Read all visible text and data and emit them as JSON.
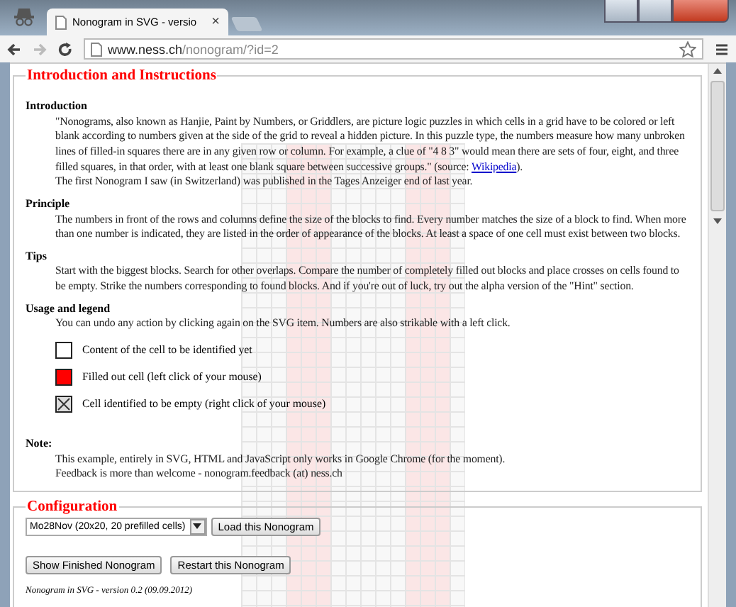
{
  "browser": {
    "tab_title": "Nonogram in SVG - versio",
    "tab_close": "×",
    "url_host": "www.ness.ch",
    "url_path": "/nonogram/?id=2"
  },
  "instructions": {
    "legend": "Introduction and Instructions",
    "topics": [
      {
        "heading": "Introduction",
        "paragraphs": [
          {
            "text": "\"Nonograms, also known as Hanjie, Paint by Numbers, or Griddlers, are picture logic puzzles in which cells in a grid have to be colored or left blank according to numbers given at the side of the grid to reveal a hidden picture. In this puzzle type, the numbers measure how many unbroken lines of filled-in squares there are in any given row or column. For example, a clue of \"4 8 3\" would mean there are sets of four, eight, and three filled squares, in that order, with at least one blank square between successive groups.\" (source: ",
            "link": "Wikipedia",
            "after": ")."
          },
          {
            "text": "The first Nonogram I saw (in Switzerland) was published in the Tages Anzeiger end of last year."
          }
        ]
      },
      {
        "heading": "Principle",
        "paragraphs": [
          {
            "text": "The numbers in front of the rows and columns define the size of the blocks to find. Every number matches the size of a block to find. When more than one number is indicated, they are listed in the order of appearance of the blocks. At least a space of one cell must exist between two blocks."
          }
        ]
      },
      {
        "heading": "Tips",
        "paragraphs": [
          {
            "text": "Start with the biggest blocks. Search for other overlaps. Compare the number of completely filled out blocks and place crosses on cells found to be empty. Strike the numbers corresponding to found blocks. And if you're out of luck, try out the alpha version of the \"Hint\" section."
          }
        ]
      },
      {
        "heading": "Usage and legend",
        "paragraphs": [
          {
            "text": "You can undo any action by clicking again on the SVG item. Numbers are also strikable with a left click."
          }
        ],
        "legend_items": [
          {
            "kind": "empty",
            "label": "Content of the cell to be identified yet"
          },
          {
            "kind": "filled",
            "label": "Filled out cell (left click of your mouse)"
          },
          {
            "kind": "crossed",
            "label": "Cell identified to be empty (right click of your mouse)"
          }
        ]
      },
      {
        "heading": "Note:",
        "paragraphs": [
          {
            "text": "This example, entirely in SVG, HTML and JavaScript only works in Google Chrome (for the moment)."
          },
          {
            "text": "Feedback is more than welcome - nonogram.feedback (at) ness.ch"
          }
        ]
      }
    ]
  },
  "configuration": {
    "legend": "Configuration",
    "select_value": "Mo28Nov (20x20, 20 prefilled cells)",
    "load_button": "Load this Nonogram",
    "buttons": [
      "Show Finished Nonogram",
      "Restart this Nonogram"
    ],
    "footer": "Nonogram in SVG - version 0.2 (09.09.2012)"
  }
}
